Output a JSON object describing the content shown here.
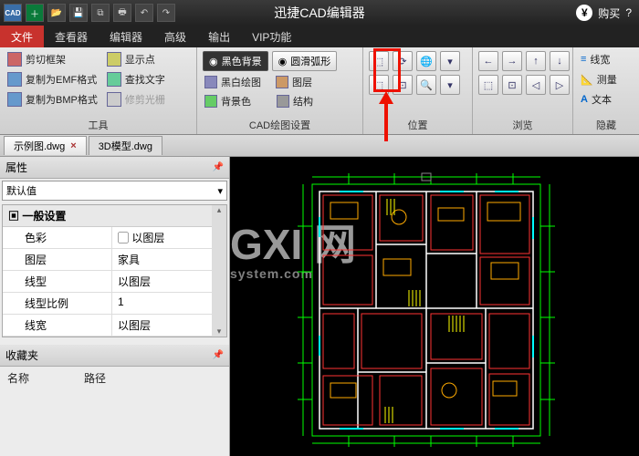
{
  "title": "迅捷CAD编辑器",
  "titlebar": {
    "buy": "购买"
  },
  "menu": {
    "file": "文件",
    "viewer": "查看器",
    "editor": "编辑器",
    "advanced": "高级",
    "output": "输出",
    "vip": "VIP功能"
  },
  "ribbon": {
    "g1": {
      "clip": "剪切框架",
      "emf": "复制为EMF格式",
      "bmp": "复制为BMP格式",
      "showpt": "显示点",
      "findtext": "查找文字",
      "trimlight": "修剪光栅",
      "label": "工具"
    },
    "g2": {
      "blackbg": "黑色背景",
      "smootharc": "圆滑弧形",
      "bwdraw": "黑白绘图",
      "layer": "图层",
      "bgcolor": "背景色",
      "struct": "结构",
      "label": "CAD绘图设置"
    },
    "g3": {
      "label": "位置"
    },
    "g4": {
      "label": "浏览"
    },
    "g5": {
      "linew": "线宽",
      "measure": "测量",
      "text": "文本",
      "label": "隐藏"
    }
  },
  "tabs": {
    "t1": "示例图.dwg",
    "t2": "3D模型.dwg"
  },
  "panel": {
    "props_title": "属性",
    "default": "默认值",
    "general": "一般设置",
    "rows": {
      "color_k": "色彩",
      "color_v": "以图层",
      "layer_k": "图层",
      "layer_v": "家具",
      "ltype_k": "线型",
      "ltype_v": "以图层",
      "lscale_k": "线型比例",
      "lscale_v": "1",
      "lwidth_k": "线宽",
      "lwidth_v": "以图层"
    },
    "fav_title": "收藏夹",
    "fav_name": "名称",
    "fav_path": "路径"
  },
  "watermark": {
    "big": "GXI 网",
    "small": "system.com"
  }
}
